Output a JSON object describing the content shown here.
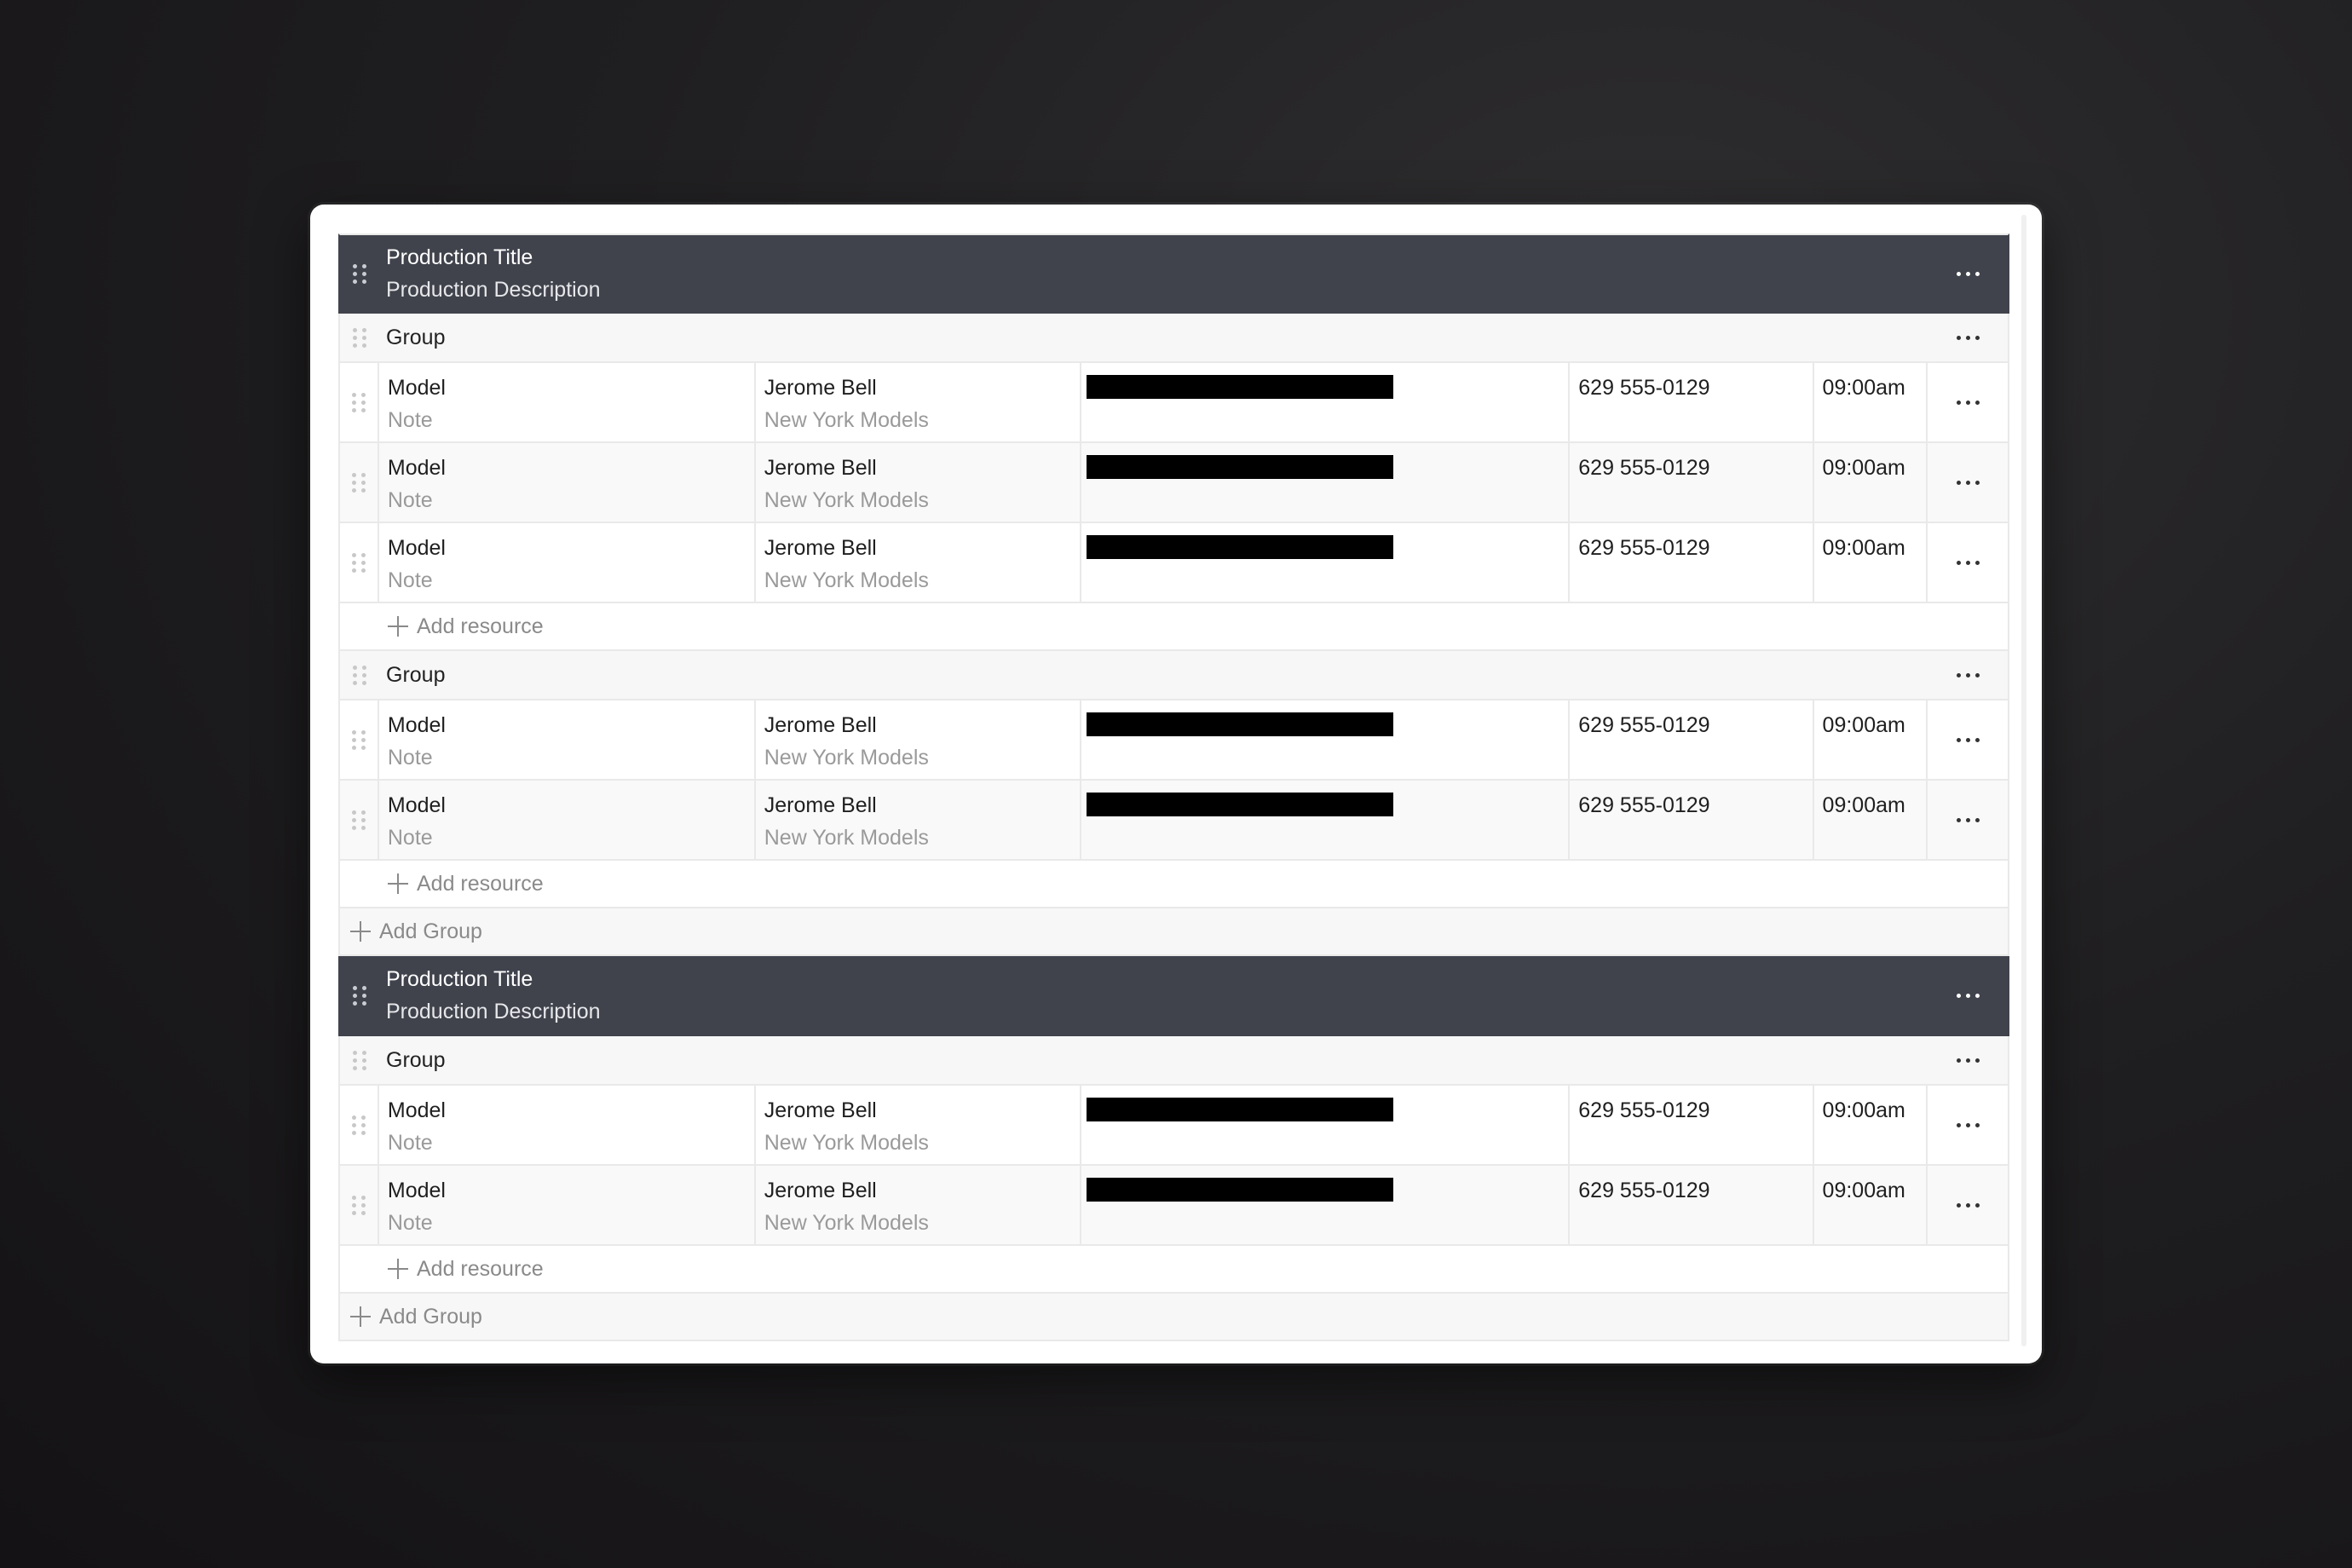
{
  "productions": [
    {
      "title": "Production Title",
      "description": "Production Description",
      "groups": [
        {
          "label": "Group",
          "resources": [
            {
              "role": "Model",
              "note": "Note",
              "name": "Jerome Bell",
              "agency": "New York Models",
              "phone": "629 555-0129",
              "time": "09:00am"
            },
            {
              "role": "Model",
              "note": "Note",
              "name": "Jerome Bell",
              "agency": "New York Models",
              "phone": "629 555-0129",
              "time": "09:00am"
            },
            {
              "role": "Model",
              "note": "Note",
              "name": "Jerome Bell",
              "agency": "New York Models",
              "phone": "629 555-0129",
              "time": "09:00am"
            }
          ],
          "add_resource_label": "Add resource"
        },
        {
          "label": "Group",
          "resources": [
            {
              "role": "Model",
              "note": "Note",
              "name": "Jerome Bell",
              "agency": "New York Models",
              "phone": "629 555-0129",
              "time": "09:00am"
            },
            {
              "role": "Model",
              "note": "Note",
              "name": "Jerome Bell",
              "agency": "New York Models",
              "phone": "629 555-0129",
              "time": "09:00am"
            }
          ],
          "add_resource_label": "Add resource"
        }
      ],
      "add_group_label": "Add Group"
    },
    {
      "title": "Production Title",
      "description": "Production Description",
      "groups": [
        {
          "label": "Group",
          "resources": [
            {
              "role": "Model",
              "note": "Note",
              "name": "Jerome Bell",
              "agency": "New York Models",
              "phone": "629 555-0129",
              "time": "09:00am"
            },
            {
              "role": "Model",
              "note": "Note",
              "name": "Jerome Bell",
              "agency": "New York Models",
              "phone": "629 555-0129",
              "time": "09:00am"
            }
          ],
          "add_resource_label": "Add resource"
        }
      ],
      "add_group_label": "Add Group"
    }
  ],
  "icons": {
    "drag": "drag-handle-icon",
    "more": "more-horizontal-icon",
    "add": "plus-icon"
  },
  "colors": {
    "production_header_bg": "#40434c",
    "group_bg": "#f7f7f7",
    "redaction": "#000000"
  }
}
